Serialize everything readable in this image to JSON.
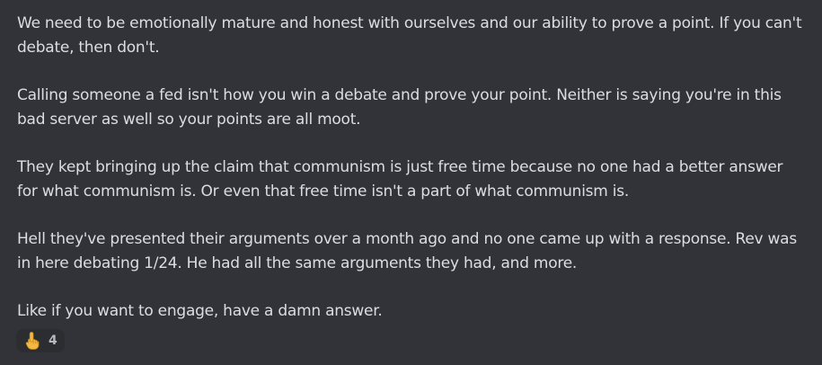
{
  "message": {
    "paragraphs": [
      "We need to be emotionally mature and honest with ourselves and our ability to prove a point. If you can't debate, then don't.",
      "Calling someone a fed isn't how you win a debate and prove your point. Neither is saying you're in this bad server as well so your points are all moot.",
      "They kept bringing up the claim that communism is just free time because no one had a better answer for what communism is. Or even that free time isn't a part of what communism is.",
      "Hell they've presented their arguments over a month ago and no one came up with a response. Rev was in here debating 1/24. He had all the same arguments they had, and more.",
      "Like if you want to engage, have a damn answer."
    ]
  },
  "reactions": [
    {
      "emoji_icon": "pointing-up-hand-icon",
      "count": "4"
    }
  ],
  "colors": {
    "background": "#313338",
    "text": "#dbdee1",
    "reaction_bg": "#2b2d31",
    "reaction_count": "#b5bac1",
    "emoji_skin": "#f4b942"
  }
}
